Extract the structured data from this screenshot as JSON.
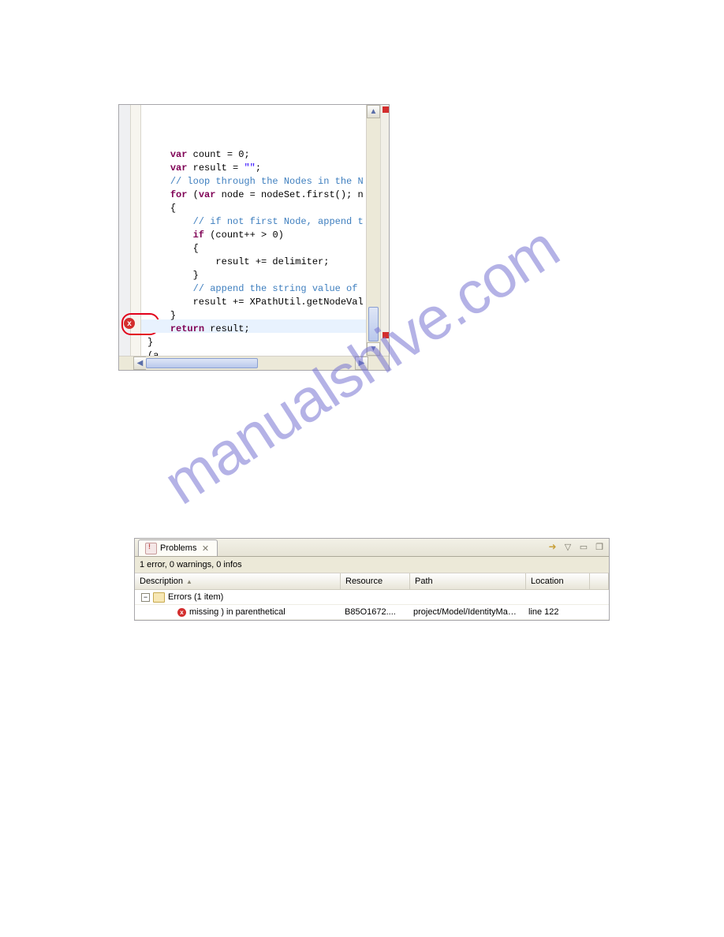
{
  "watermark": "manualshive.com",
  "editor": {
    "code_lines": [
      {
        "indent": 0,
        "tokens": [
          [
            "kw",
            "var"
          ],
          [
            "pl",
            " count = "
          ],
          [
            "nm",
            "0"
          ],
          [
            "pl",
            ";"
          ]
        ]
      },
      {
        "indent": 0,
        "tokens": [
          [
            "kw",
            "var"
          ],
          [
            "pl",
            " result = "
          ],
          [
            "str",
            "\"\""
          ],
          [
            "pl",
            ";"
          ]
        ]
      },
      {
        "indent": 0,
        "tokens": [
          [
            "cm",
            "// loop through the Nodes in the N"
          ]
        ]
      },
      {
        "indent": 0,
        "tokens": [
          [
            "kw",
            "for"
          ],
          [
            "pl",
            " ("
          ],
          [
            "kw",
            "var"
          ],
          [
            "pl",
            " node = nodeSet.first(); n"
          ]
        ]
      },
      {
        "indent": 0,
        "tokens": [
          [
            "pl",
            "{"
          ]
        ]
      },
      {
        "indent": 1,
        "tokens": [
          [
            "cm",
            "// if not first Node, append t"
          ]
        ]
      },
      {
        "indent": 1,
        "tokens": [
          [
            "kw",
            "if"
          ],
          [
            "pl",
            " (count++ > "
          ],
          [
            "nm",
            "0"
          ],
          [
            "pl",
            ")"
          ]
        ]
      },
      {
        "indent": 1,
        "tokens": [
          [
            "pl",
            "{"
          ]
        ]
      },
      {
        "indent": 2,
        "tokens": [
          [
            "pl",
            "result += delimiter;"
          ]
        ]
      },
      {
        "indent": 1,
        "tokens": [
          [
            "pl",
            "}"
          ]
        ]
      },
      {
        "indent": 1,
        "tokens": [
          [
            "cm",
            "// append the string value of "
          ]
        ]
      },
      {
        "indent": 1,
        "tokens": [
          [
            "pl",
            "result += XPathUtil.getNodeVal"
          ]
        ]
      },
      {
        "indent": 0,
        "tokens": [
          [
            "pl",
            "}"
          ]
        ]
      },
      {
        "indent": 0,
        "tokens": [
          [
            "kw",
            "return"
          ],
          [
            "pl",
            " result;"
          ]
        ]
      },
      {
        "indent": -1,
        "tokens": [
          [
            "pl",
            "}"
          ]
        ]
      },
      {
        "indent": -1,
        "tokens": [
          [
            "pl",
            "(a"
          ]
        ]
      },
      {
        "indent": -1,
        "tokens": [
          [
            "pl",
            ""
          ]
        ]
      }
    ],
    "error_marker_glyph": "x"
  },
  "problems": {
    "tab_label": "Problems",
    "status": "1 error, 0 warnings, 0 infos",
    "columns": {
      "description": "Description",
      "resource": "Resource",
      "path": "Path",
      "location": "Location"
    },
    "group_label": "Errors (1 item)",
    "rows": [
      {
        "description": "missing ) in parenthetical",
        "resource": "B85O1672....",
        "path": "project/Model/IdentityMan...",
        "location": "line 122"
      }
    ],
    "tree_toggle_glyph": "−"
  }
}
